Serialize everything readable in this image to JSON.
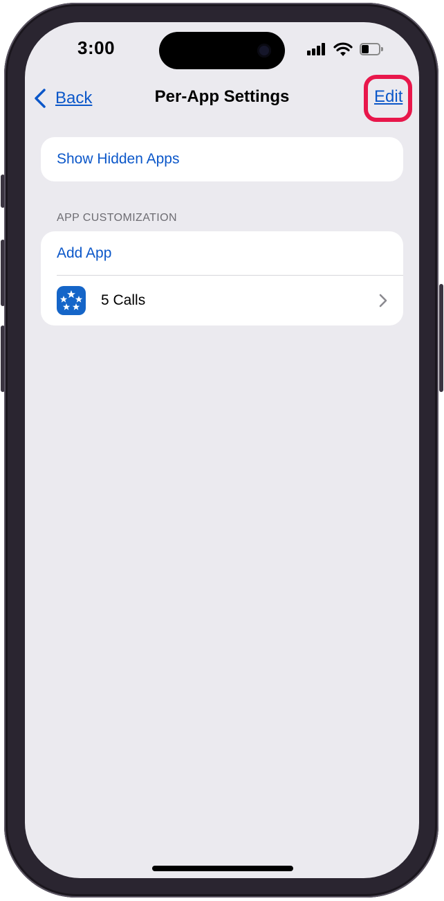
{
  "status_bar": {
    "time": "3:00",
    "signal_icon": "cellular-signal-icon",
    "wifi_icon": "wifi-icon",
    "battery_icon": "battery-icon",
    "battery_level": 0.4
  },
  "nav": {
    "back_label": "Back",
    "title": "Per-App Settings",
    "edit_label": "Edit",
    "highlight_color": "#e8174b"
  },
  "top_group": {
    "show_hidden_label": "Show Hidden Apps"
  },
  "app_customization": {
    "section_header": "APP CUSTOMIZATION",
    "add_app_label": "Add App",
    "apps": [
      {
        "name": "5 Calls",
        "icon": "five-calls-app-icon"
      }
    ]
  },
  "colors": {
    "accent": "#0b57c9",
    "background": "#ebeaef",
    "card": "#ffffff"
  }
}
